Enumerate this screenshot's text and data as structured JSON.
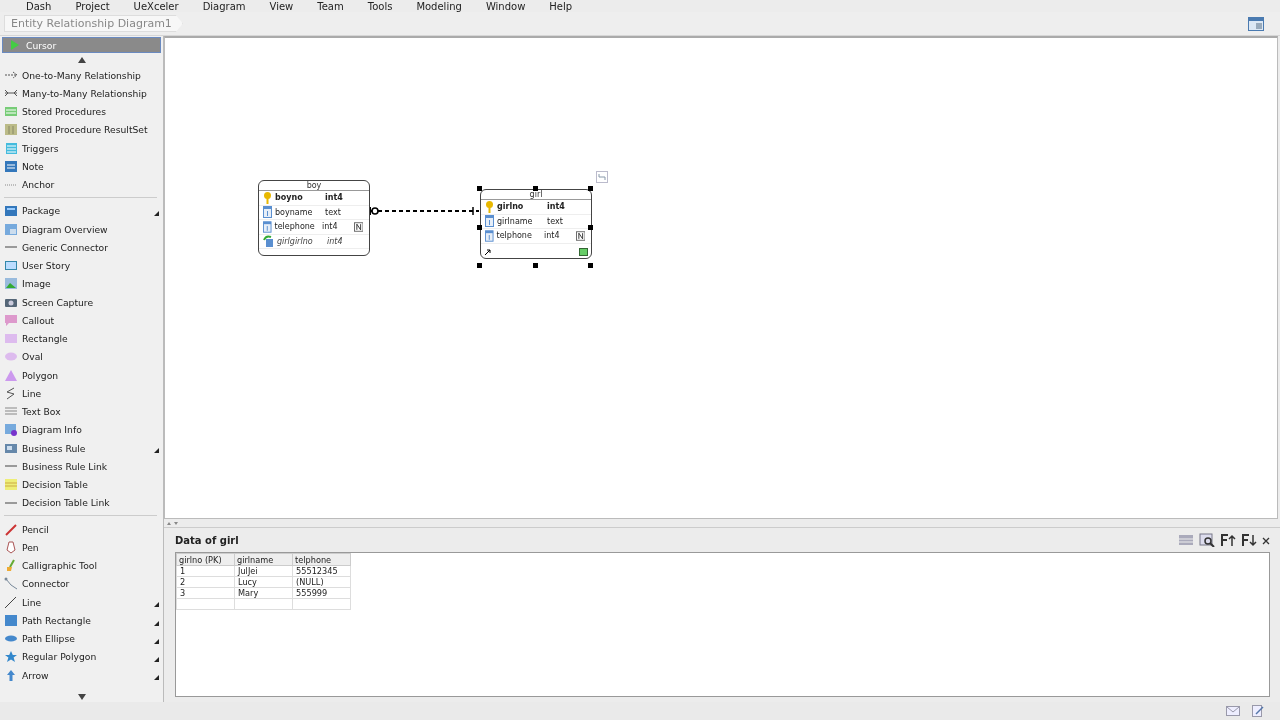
{
  "menu_bar": [
    "Dash",
    "Project",
    "UeXceler",
    "Diagram",
    "View",
    "Team",
    "Tools",
    "Modeling",
    "Window",
    "Help"
  ],
  "breadcrumb": "Entity Relationship Diagram1",
  "palette": {
    "header": {
      "label": "Cursor",
      "selected": true
    },
    "groups": [
      [
        {
          "label": "One-to-Many Relationship",
          "kind": "one-many",
          "submenu": false
        },
        {
          "label": "Many-to-Many Relationship",
          "kind": "many-many",
          "submenu": false
        },
        {
          "label": "Stored Procedures",
          "kind": "procedure",
          "submenu": false
        },
        {
          "label": "Stored Procedure ResultSet",
          "kind": "resultset",
          "submenu": false
        },
        {
          "label": "Triggers",
          "kind": "trigger",
          "submenu": false
        },
        {
          "label": "Note",
          "kind": "note",
          "submenu": false
        },
        {
          "label": "Anchor",
          "kind": "anchor",
          "submenu": false
        }
      ],
      [
        {
          "label": "Package",
          "kind": "package",
          "submenu": true
        },
        {
          "label": "Diagram Overview",
          "kind": "overview",
          "submenu": false
        },
        {
          "label": "Generic Connector",
          "kind": "hline",
          "submenu": false
        },
        {
          "label": "User Story",
          "kind": "story",
          "submenu": false
        },
        {
          "label": "Image",
          "kind": "image",
          "submenu": false
        },
        {
          "label": "Screen Capture",
          "kind": "camera",
          "submenu": false
        },
        {
          "label": "Callout",
          "kind": "callout",
          "submenu": false
        },
        {
          "label": "Rectangle",
          "kind": "rect",
          "submenu": false
        },
        {
          "label": "Oval",
          "kind": "oval",
          "submenu": false
        },
        {
          "label": "Polygon",
          "kind": "triangle",
          "submenu": false
        },
        {
          "label": "Line",
          "kind": "zigzag",
          "submenu": false
        },
        {
          "label": "Text Box",
          "kind": "textbox",
          "submenu": false
        },
        {
          "label": "Diagram Info",
          "kind": "info",
          "submenu": false
        },
        {
          "label": "Business Rule",
          "kind": "rule",
          "submenu": true
        },
        {
          "label": "Business Rule Link",
          "kind": "hline",
          "submenu": false
        },
        {
          "label": "Decision Table",
          "kind": "dtable",
          "submenu": false
        },
        {
          "label": "Decision Table Link",
          "kind": "hline",
          "submenu": false
        }
      ],
      [
        {
          "label": "Pencil",
          "kind": "pencil",
          "submenu": false
        },
        {
          "label": "Pen",
          "kind": "pen",
          "submenu": false
        },
        {
          "label": "Calligraphic Tool",
          "kind": "brush",
          "submenu": false
        },
        {
          "label": "Connector",
          "kind": "connector",
          "submenu": false
        },
        {
          "label": "Line",
          "kind": "diag",
          "submenu": true
        },
        {
          "label": "Path Rectangle",
          "kind": "prect",
          "submenu": true
        },
        {
          "label": "Path Ellipse",
          "kind": "poval",
          "submenu": true
        },
        {
          "label": "Regular Polygon",
          "kind": "star",
          "submenu": true
        },
        {
          "label": "Arrow",
          "kind": "arrow",
          "submenu": true
        }
      ]
    ]
  },
  "entities": [
    {
      "name": "boy",
      "selected": false,
      "columns": [
        {
          "name": "boyno",
          "type": "int4",
          "kind": "pk",
          "nullable": false
        },
        {
          "name": "boyname",
          "type": "text",
          "kind": "none",
          "nullable": false
        },
        {
          "name": "telephone",
          "type": "int4",
          "kind": "none",
          "nullable": true
        },
        {
          "name": "girlgirlno",
          "type": "int4",
          "kind": "fk",
          "nullable": false
        }
      ]
    },
    {
      "name": "girl",
      "selected": true,
      "columns": [
        {
          "name": "girlno",
          "type": "int4",
          "kind": "pk",
          "nullable": false
        },
        {
          "name": "girlname",
          "type": "text",
          "kind": "none",
          "nullable": false
        },
        {
          "name": "telphone",
          "type": "int4",
          "kind": "none",
          "nullable": true
        }
      ]
    }
  ],
  "data_panel": {
    "title": "Data of girl",
    "columns": [
      "girlno (PK)",
      "girlname",
      "telphone"
    ],
    "rows": [
      [
        "1",
        "JulJei",
        "55512345"
      ],
      [
        "2",
        "Lucy",
        "(NULL)"
      ],
      [
        "3",
        "Mary",
        "555999"
      ]
    ]
  }
}
